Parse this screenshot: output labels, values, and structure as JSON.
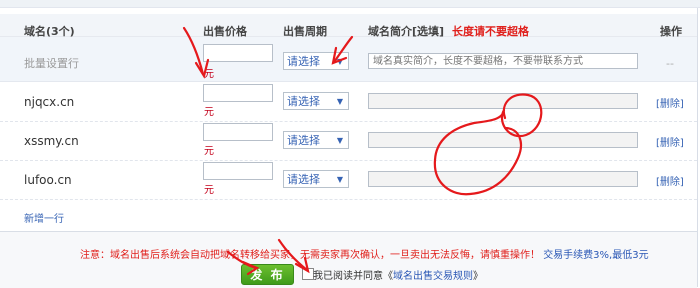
{
  "header": {
    "domain_col": "域名(3个)",
    "price_col": "出售价格",
    "period_col": "出售周期",
    "intro_col": "域名简介[选填]",
    "intro_warn": "长度请不要超格",
    "action_col": "操作"
  },
  "batch": {
    "label": "批量设置行",
    "price_value": "",
    "currency": "元",
    "period": "请选择",
    "intro_placeholder": "域名真实简介，长度不要超格，不要带联系方式",
    "action": "--"
  },
  "rows": [
    {
      "domain": "njqcx.cn",
      "price_value": "",
      "currency": "元",
      "period": "请选择",
      "intro": "",
      "action": "[删除]"
    },
    {
      "domain": "xssmy.cn",
      "price_value": "",
      "currency": "元",
      "period": "请选择",
      "intro": "",
      "action": "[删除]"
    },
    {
      "domain": "lufoo.cn",
      "price_value": "",
      "currency": "元",
      "period": "请选择",
      "intro": "",
      "action": "[删除]"
    }
  ],
  "add_row_label": "新增一行",
  "notice": {
    "text": "注意：域名出售后系统会自动把域名转移给买家，无需卖家再次确认，一旦卖出无法反悔，请慎重操作！",
    "fee": "交易手续费3%,最低3元"
  },
  "publish_label": "发 布",
  "agree": {
    "prefix": "我已阅读并同意《",
    "link": "域名出售交易规则",
    "suffix": "》"
  },
  "icons": {
    "dropdown": "▼"
  },
  "colors": {
    "accent_blue": "#3663b4",
    "warning_red": "#e0201c",
    "publish_green": "#4fa91f",
    "annotation_red": "#e5191c"
  }
}
